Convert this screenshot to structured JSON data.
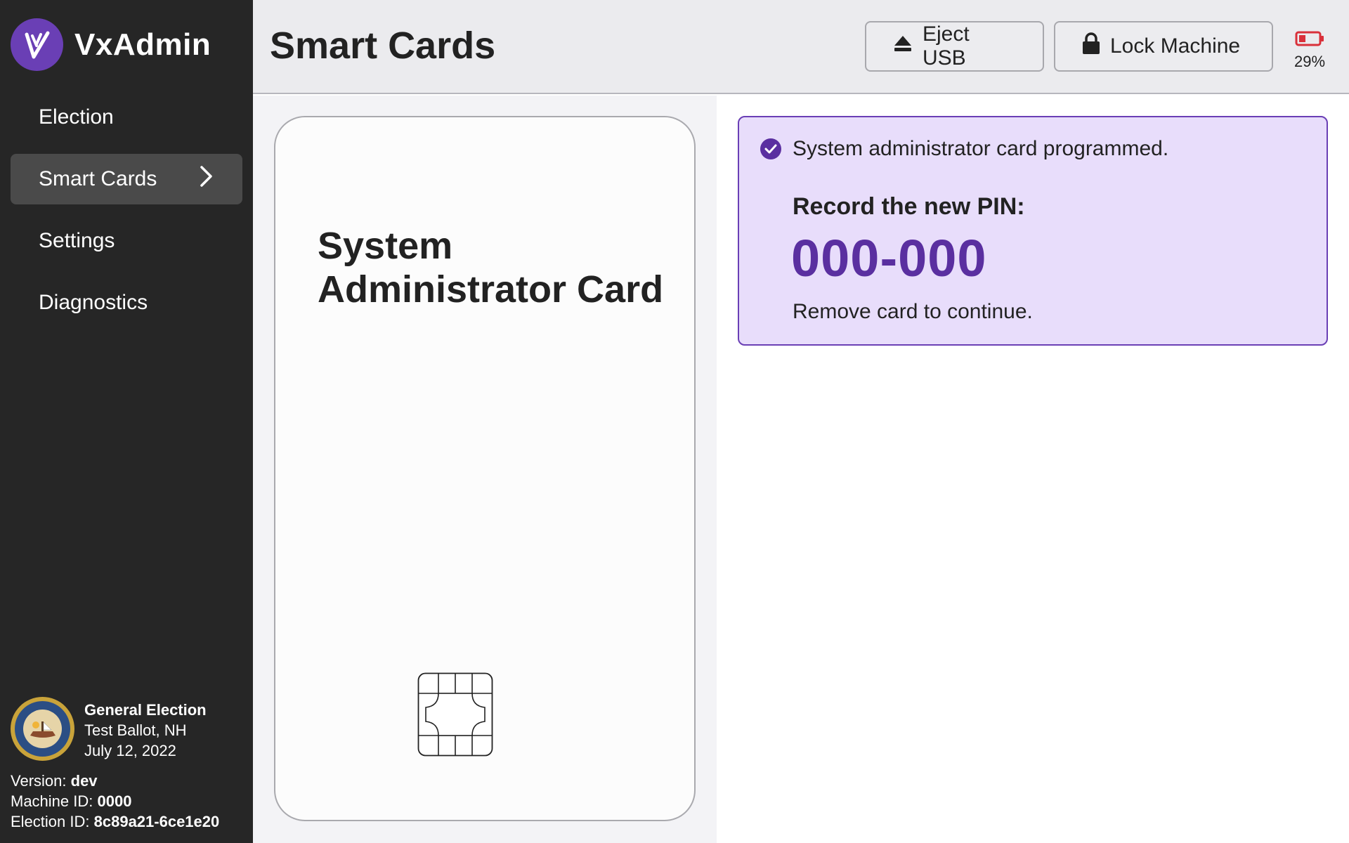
{
  "app": {
    "name": "VxAdmin"
  },
  "sidebar": {
    "items": [
      {
        "label": "Election",
        "active": false
      },
      {
        "label": "Smart Cards",
        "active": true
      },
      {
        "label": "Settings",
        "active": false
      },
      {
        "label": "Diagnostics",
        "active": false
      }
    ],
    "election": {
      "title": "General Election",
      "ballot": "Test Ballot, NH",
      "date": "July 12, 2022"
    },
    "meta": {
      "version_label": "Version:",
      "version_value": "dev",
      "machine_label": "Machine ID:",
      "machine_value": "0000",
      "election_id_label": "Election ID:",
      "election_id_value": "8c89a21-6ce1e20"
    }
  },
  "header": {
    "title": "Smart Cards",
    "eject_label": "Eject USB",
    "lock_label": "Lock Machine",
    "battery_percent": "29%"
  },
  "card": {
    "title_line1": "System",
    "title_line2": "Administrator Card"
  },
  "callout": {
    "status": "System administrator card programmed.",
    "pin_label": "Record the new PIN:",
    "pin_value": "000-000",
    "remove_message": "Remove card to continue."
  },
  "colors": {
    "accent": "#6a3fb5",
    "pin_color": "#5a2fa0",
    "callout_bg": "#e8ddfb",
    "sidebar_bg": "#262626",
    "battery_low": "#d9303a"
  },
  "icons": {
    "logo": "vx-logo-icon",
    "chevron": "chevron-right-icon",
    "eject": "eject-icon",
    "lock": "lock-icon",
    "battery": "battery-low-icon",
    "check": "check-circle-icon",
    "chip": "smart-card-chip-icon",
    "seal": "state-seal-icon"
  }
}
